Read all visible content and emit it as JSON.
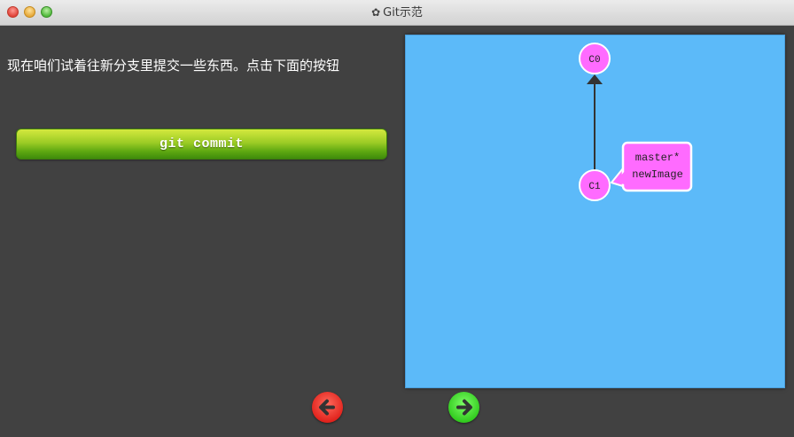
{
  "window": {
    "title": "Git示范",
    "title_icon": "gear-icon"
  },
  "instruction": {
    "text": "现在咱们试着往新分支里提交一些东西。点击下面的按钮"
  },
  "commit_button": {
    "label": "git commit"
  },
  "graph": {
    "commits": [
      {
        "id": "C0"
      },
      {
        "id": "C1"
      }
    ],
    "branch_label": {
      "lines": [
        "master*",
        "newImage"
      ]
    }
  },
  "nav": {
    "back_icon": "arrow-left-icon",
    "forward_icon": "arrow-right-icon"
  },
  "colors": {
    "canvas": "#5cbaf9",
    "commit_fill": "#ff6bff",
    "commit_stroke": "#ffffff",
    "edge": "#333333",
    "back_button": "#e0201a",
    "forward_button": "#2fc81c"
  }
}
